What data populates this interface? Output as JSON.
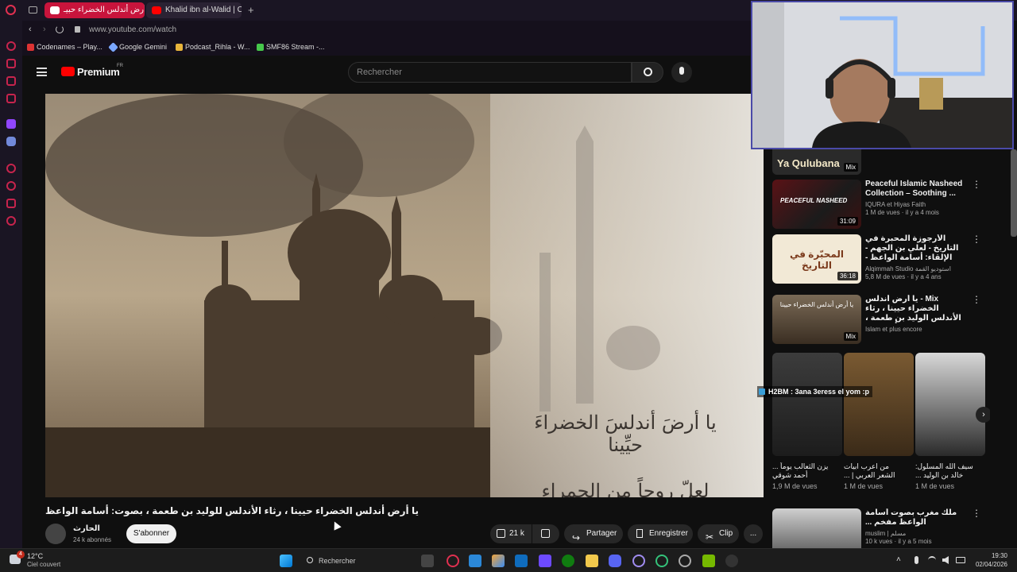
{
  "browser": {
    "tabs": [
      {
        "label": "يا أرض أندلس الخضراء حبيـ"
      },
      {
        "label": "Khalid ibn al-Walid | Chapt"
      }
    ],
    "new_tab": "+",
    "url": "www.youtube.com/watch",
    "bookmarks": [
      {
        "label": "Codenames – Play...",
        "color": "#d33"
      },
      {
        "label": "Google Gemini",
        "color": "#7aa7ff"
      },
      {
        "label": "Podcast_Rihla - W...",
        "color": "#e8b53b"
      },
      {
        "label": "SMF86 Stream -...",
        "color": "#46c84b"
      }
    ]
  },
  "youtube": {
    "logo": "Premium",
    "region": "FR",
    "search_placeholder": "Rechercher",
    "video": {
      "overlay_line1": "يا أرضَ أندلسَ الخضراءَ حيِّينا",
      "overlay_line2": "لعلّ روحاً من الحمراءِ تُحيينا",
      "title": "يا أرض أندلس الخضراء حيينا ، رثاء الأندلس للوليد بن طعمة ، بصوت: أسامة الواعظ",
      "channel": "الحارث",
      "subscribers": "24 k abonnés",
      "subscribe_label": "S'abonner",
      "likes": "21 k",
      "share": "Partager",
      "save": "Enregistrer",
      "clip": "Clip",
      "more": "..."
    },
    "recommendations": [
      {
        "title": "Peaceful Islamic Nasheed Collection – Soothing ...",
        "channel": "IQURA et Hiyas Faith",
        "stats": "1 M de vues · il y a 4 mois",
        "duration": "31:09",
        "thumb_text": "PEACEFUL NASHEED"
      },
      {
        "title": "الأرجوزة المحبرة في التاريخ - لعلي بن الجهم - الإلقاء: أسامة الواعظ -",
        "channel": "Alqimmah Studio استوديو القمة",
        "stats": "5,8 M de vues · il y a 4 ans",
        "duration": "36:18",
        "thumb_text": "المحبّرة في التاريخ"
      },
      {
        "title": "Mix - يا أرض أندلس الخضراء حيينا ، رثاء الأندلس الوليد بن طعمة ، بصوت: أسامة ...",
        "channel": "Islam et plus encore",
        "stats": "",
        "duration": "Mix",
        "thumb_text": "يا أرض أندلس الخضراء حيينا"
      }
    ],
    "top_thumb_text": "Ya Qulubana",
    "top_thumb_badge": "Mix",
    "shorts": [
      {
        "title": "يزن الثعالب يوماً ... أحمد شوقي",
        "views": "1,9 M de vues"
      },
      {
        "title": "من اعرب ابيات الشعر العربي | ...",
        "views": "1 M de vues"
      },
      {
        "title": "سيف الله المسلول: خالد بن الوليد ...",
        "views": "1 M de vues"
      }
    ],
    "chat_overlay": "H2BM : 3ana 3eress el yom :p",
    "next_rec": {
      "title": "ملك مغرب بصوت أسامة الواعظ مفخم ...",
      "channel": "muslim | مسلم",
      "stats": "10 k vues · il y a 5 mois"
    }
  },
  "taskbar": {
    "weather_temp": "12°C",
    "weather_desc": "Ciel couvert",
    "notif_count": "4",
    "search_placeholder": "Rechercher",
    "time": "19:30",
    "date": "02/04/2026"
  }
}
